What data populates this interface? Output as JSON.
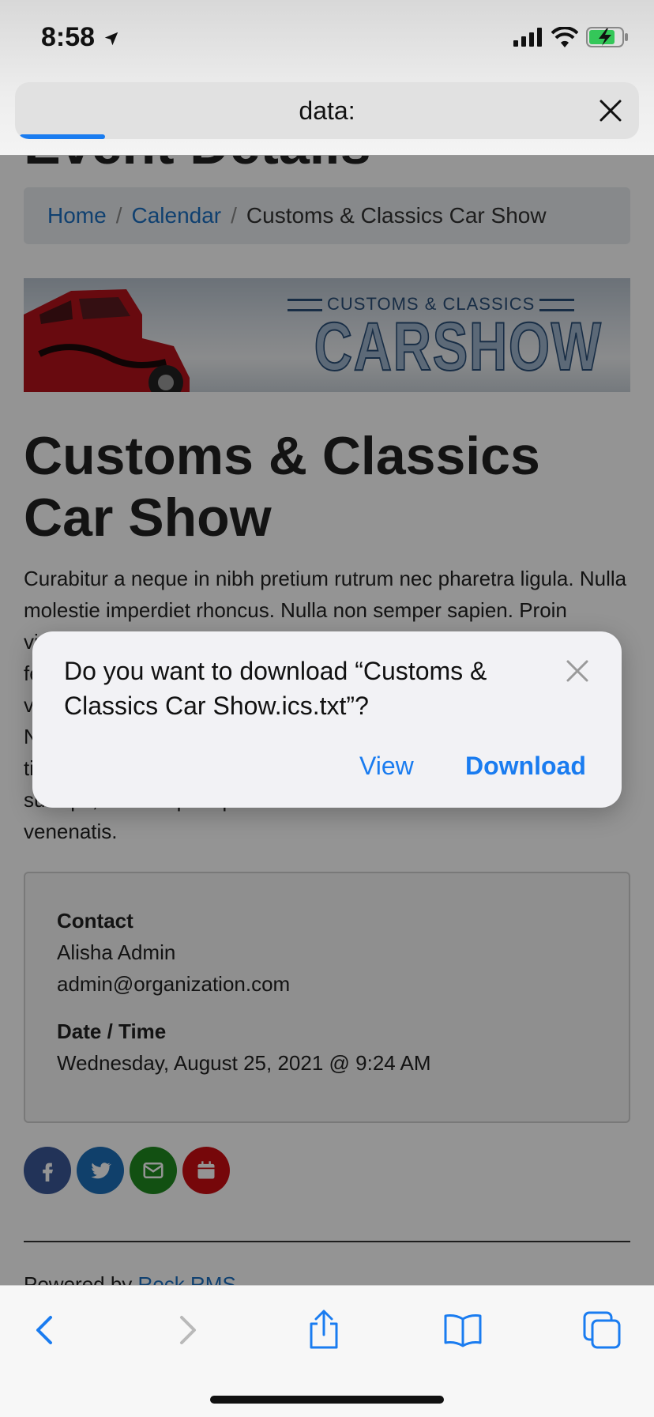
{
  "status_bar": {
    "time": "8:58"
  },
  "address_bar": {
    "url": "data:"
  },
  "page": {
    "partial_heading": "Event Details",
    "breadcrumb": {
      "home": "Home",
      "calendar": "Calendar",
      "current": "Customs & Classics Car Show"
    },
    "banner": {
      "line1": "CUSTOMS & CLASSICS",
      "line2": "CARSHOW"
    },
    "title": "Customs & Classics Car Show",
    "description": "Curabitur a neque in nibh pretium rutrum nec pharetra ligula. Nulla molestie imperdiet rhoncus. Nulla non semper sapien. Proin viverra mattis sem, sit amet consequat nisl tincidunt et. Praesent feugiat massa id dolor varius, non tempor nibh vehicula. Nunc varius vulputate nibh, vitae sagittis nisl. Sed vitae commodo urna. Nullam ut risus nulla. Vestibulum tincidunt nisi ut ipsum iaculis tincidunt. Suspendisse potenti. Sed sollicitudin lorem eu felis suscipit, sed tempus quam eu sodales. Nulla ornare venenatis venenatis.",
    "contact_label": "Contact",
    "contact_name": "Alisha Admin",
    "contact_email": "admin@organization.com",
    "datetime_label": "Date / Time",
    "datetime_value": "Wednesday, August 25, 2021 @ 9:24 AM",
    "powered_prefix": "Powered by",
    "powered_link": "Rock RMS"
  },
  "dialog": {
    "message": "Do you want to download “Customs & Classics Car Show.ics.txt”?",
    "view_label": "View",
    "download_label": "Download"
  },
  "colors": {
    "accent": "#1a7cf0",
    "link": "#1b6fc1",
    "facebook": "#3b5998",
    "twitter": "#1d6fb8",
    "email": "#1f8a1f",
    "calendar": "#cc0d12"
  }
}
